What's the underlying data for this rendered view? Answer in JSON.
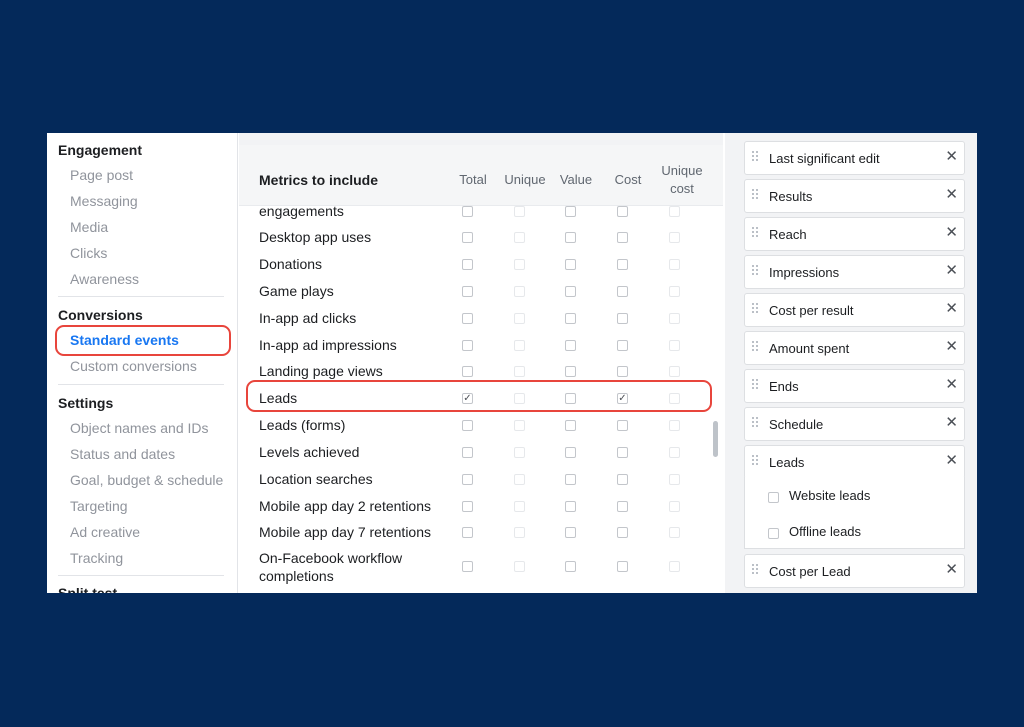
{
  "sidebar": {
    "engagement": {
      "heading": "Engagement",
      "items": [
        "Page post",
        "Messaging",
        "Media",
        "Clicks",
        "Awareness"
      ]
    },
    "conversions": {
      "heading": "Conversions",
      "items": [
        "Standard events",
        "Custom conversions"
      ]
    },
    "settings": {
      "heading": "Settings",
      "items": [
        "Object names and IDs",
        "Status and dates",
        "Goal, budget & schedule",
        "Targeting",
        "Ad creative",
        "Tracking"
      ]
    },
    "split_test": {
      "heading": "Split test"
    }
  },
  "metrics": {
    "title": "Metrics to include",
    "columns": [
      "Total",
      "Unique",
      "Value",
      "Cost",
      "Unique cost"
    ],
    "rows": [
      {
        "label": "engagements",
        "checked": []
      },
      {
        "label": "Desktop app uses",
        "checked": []
      },
      {
        "label": "Donations",
        "checked": []
      },
      {
        "label": "Game plays",
        "checked": []
      },
      {
        "label": "In-app ad clicks",
        "checked": []
      },
      {
        "label": "In-app ad impressions",
        "checked": []
      },
      {
        "label": "Landing page views",
        "checked": []
      },
      {
        "label": "Leads",
        "checked": [
          "Total",
          "Cost"
        ]
      },
      {
        "label": "Leads (forms)",
        "checked": []
      },
      {
        "label": "Levels achieved",
        "checked": []
      },
      {
        "label": "Location searches",
        "checked": []
      },
      {
        "label": "Mobile app day 2 retentions",
        "checked": []
      },
      {
        "label": "Mobile app day 7 retentions",
        "checked": []
      },
      {
        "label": "On-Facebook workflow completions",
        "checked": []
      }
    ],
    "check_glyph": "✓"
  },
  "selected_columns": {
    "items": [
      "Last significant edit",
      "Results",
      "Reach",
      "Impressions",
      "Cost per result",
      "Amount spent",
      "Ends",
      "Schedule",
      "Leads",
      "Cost per Lead"
    ],
    "leads_sub": [
      "Website leads",
      "Offline leads"
    ],
    "remove_glyph": "✕"
  },
  "colors": {
    "background": "#04295a",
    "highlight": "#e8453c",
    "active_link": "#1877f2"
  }
}
